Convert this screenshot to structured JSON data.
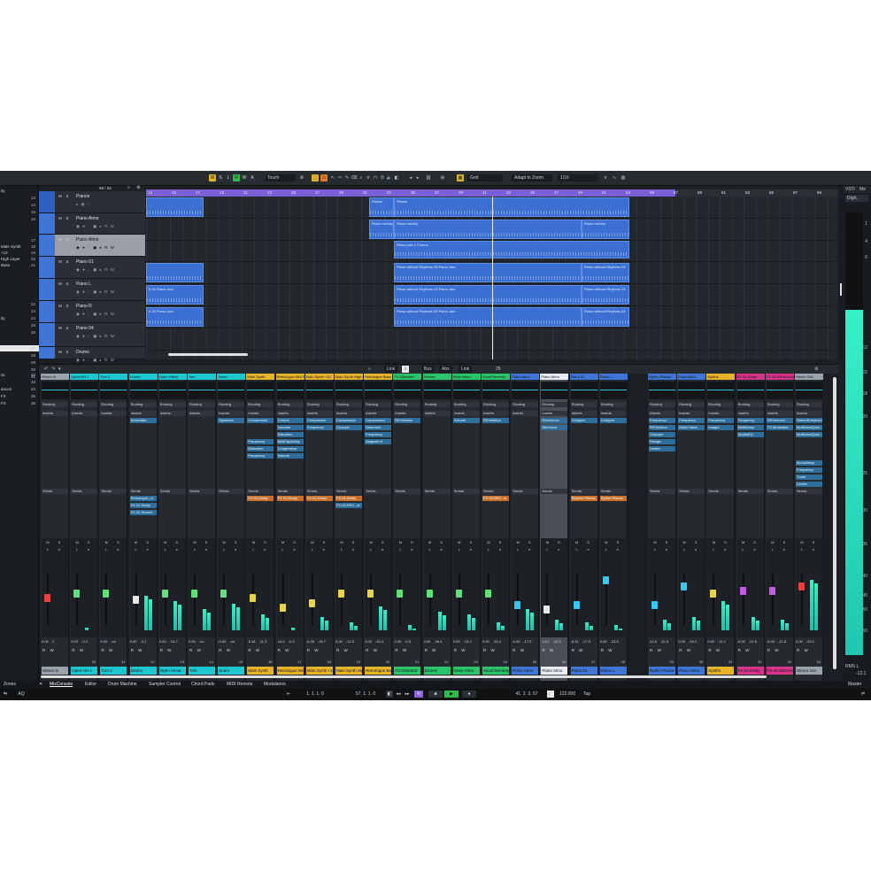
{
  "toolbar": {
    "buttons": [
      "M",
      "S",
      "L",
      "R",
      "W",
      "A"
    ],
    "automation_mode": "Touch",
    "snap_type": "Grid",
    "snap_mode": "Adapt to Zoom",
    "quantize": "1/16",
    "accent_color": "#e2b62b"
  },
  "left_zone": {
    "rows": [
      {
        "label": "ity",
        "num": ""
      },
      {
        "label": "",
        "num": "13"
      },
      {
        "label": "",
        "num": "14"
      },
      {
        "label": "",
        "num": "15"
      },
      {
        "label": "",
        "num": "16"
      },
      {
        "label": "",
        "num": "17"
      },
      {
        "label": "Male Synth",
        "num": "18"
      },
      {
        "label": "+12",
        "num": "19"
      },
      {
        "label": "High Layer",
        "num": "20"
      },
      {
        "label": "Bass",
        "num": "21"
      },
      {
        "label": "",
        "num": "22"
      },
      {
        "label": "",
        "num": "23"
      },
      {
        "label": "ity",
        "num": "24"
      },
      {
        "label": "",
        "num": "25"
      },
      {
        "label": "",
        "num": "26"
      },
      {
        "label": "",
        "num": "27"
      },
      {
        "label": "",
        "num": "28"
      },
      {
        "label": "",
        "num": "29"
      },
      {
        "label": "",
        "num": "30"
      },
      {
        "label": "",
        "num": "31"
      },
      {
        "label": "ss",
        "num": "32"
      },
      {
        "label": "",
        "num": "33"
      },
      {
        "label": "ances",
        "num": "34"
      },
      {
        "label": "FX",
        "num": "35"
      },
      {
        "label": "FX",
        "num": "36"
      }
    ],
    "zones_label": "Zones"
  },
  "tracks": {
    "header_value": "58 / 58",
    "list": [
      {
        "name": "Pianos",
        "folder": true
      },
      {
        "name": "Piano Atmo"
      },
      {
        "name": "Piano Atmo",
        "selected": true
      },
      {
        "name": "Piano 01"
      },
      {
        "name": "Piano L"
      },
      {
        "name": "Piano R"
      },
      {
        "name": "Piano 04"
      },
      {
        "name": "Drums"
      }
    ]
  },
  "ruler": {
    "bars": [
      "13",
      "15",
      "17",
      "19",
      "21",
      "23",
      "25",
      "27",
      "29",
      "31",
      "33",
      "35",
      "37",
      "39",
      "41",
      "43",
      "45",
      "47",
      "49",
      "51",
      "53",
      "55",
      "57",
      "59",
      "61",
      "63",
      "65",
      "67",
      "69"
    ]
  },
  "events": [
    {
      "lane": 0,
      "label": ""
    },
    {
      "lane": 0,
      "label": "Pianos"
    },
    {
      "lane": 0,
      "label": "Pianos"
    },
    {
      "lane": 1,
      "label": "Piano melody"
    },
    {
      "lane": 1,
      "label": "Piano melody"
    },
    {
      "lane": 1,
      "label": "Piano melody"
    },
    {
      "lane": 2,
      "label": "Piano part 4 Chorus"
    },
    {
      "lane": 3,
      "label": ""
    },
    {
      "lane": 3,
      "label": "Piano without Rhythms 25 Piano Jam"
    },
    {
      "lane": 3,
      "label": "Piano without Rhythms 25"
    },
    {
      "lane": 4,
      "label": "# 24 Piano Jam"
    },
    {
      "lane": 4,
      "label": "Piano without Rhythms 25 Piano Jam"
    },
    {
      "lane": 4,
      "label": "Piano without Rhythms 25"
    },
    {
      "lane": 5,
      "label": "# 25 Piano Jam"
    },
    {
      "lane": 5,
      "label": "Piano without Rhythms 25 Piano Jam"
    },
    {
      "lane": 5,
      "label": "Piano without Rhythms 25"
    }
  ],
  "mixer": {
    "toolbar": {
      "link1": "Link",
      "bus": "Bus",
      "abs": "Abs",
      "link2": "Link",
      "value": "26"
    },
    "section_labels": {
      "routing": "Routing",
      "inserts": "Inserts",
      "sends": "Sends"
    },
    "strips": [
      {
        "name": "Stereo In",
        "color": "#9aa3ad",
        "num": "",
        "inserts": [],
        "sends": [],
        "vol": "0.00",
        "pan": "C",
        "fader": 0.55,
        "meter": 0
      },
      {
        "name": "Open HH 1",
        "color": "#1ec7d0",
        "num": "10",
        "inserts": [],
        "sends": [],
        "vol": "0.00",
        "pan": "-0.3",
        "fader": 0.65,
        "meter": 0.05
      },
      {
        "name": "Tom 2",
        "color": "#1ec7d0",
        "num": "11",
        "inserts": [],
        "sends": [],
        "vol": "0.00",
        "pan": "-oo",
        "fader": 0.65,
        "meter": 0
      },
      {
        "name": "Drums",
        "color": "#1ec7d0",
        "num": "12",
        "inserts": [
          "Normalize"
        ],
        "sends": [
          "Retrologue_ut",
          "FX 01-Delay",
          "FX 02-Reverb"
        ],
        "vol": "0.00",
        "pan": "-3.1",
        "fader": 0.52,
        "meter": 0.65
      },
      {
        "name": "Open HiHat",
        "color": "#1ec7d0",
        "num": "13",
        "inserts": [],
        "sends": [],
        "vol": "0.00",
        "pan": "-14.7",
        "fader": 0.65,
        "meter": 0.55
      },
      {
        "name": "Tom",
        "color": "#1ec7d0",
        "num": "14",
        "inserts": [],
        "sends": [],
        "vol": "0.00",
        "pan": "-oo",
        "fader": 0.65,
        "meter": 0.4
      },
      {
        "name": "Snare",
        "color": "#1ec7d0",
        "num": "15",
        "inserts": [
          "Squasher"
        ],
        "sends": [],
        "vol": "-0.65",
        "pan": "-oo",
        "fader": 0.65,
        "meter": 0.5
      },
      {
        "name": "Main Synth",
        "color": "#e6b42a",
        "num": "16",
        "inserts": [
          "Compressor",
          "",
          "",
          "Frequency",
          "Distortion",
          "Frequency"
        ],
        "sends": [
          "FX 01-Delay"
        ],
        "vol": "-5.18",
        "pan": "-11.3",
        "fader": 0.55,
        "meter": 0.3
      },
      {
        "name": "Retrologue Mini Synth",
        "color": "#e6b42a",
        "num": "17",
        "inserts": [
          "Chorus",
          "Vocoder",
          "Distortion",
          "MultiTapDelay",
          "Compressor",
          "Volume"
        ],
        "sends": [
          "FX 01-Delay"
        ],
        "vol": "-14.0",
        "pan": "-0.3",
        "fader": 0.35,
        "meter": 0.05
      },
      {
        "name": "Main Synth +12",
        "color": "#e6b42a",
        "num": "18",
        "inserts": [
          "Compressor",
          "Frequency"
        ],
        "sends": [
          "FX 01-Delay"
        ],
        "vol": "-0.45",
        "pan": "-16.7",
        "fader": 0.45,
        "meter": 0.25
      },
      {
        "name": "Main Synth High Layer",
        "color": "#e6b42a",
        "num": "19",
        "inserts": [
          "Compressor",
          "Chopper"
        ],
        "sends": [
          "FX 01-Delay",
          "FX 02-REV...er"
        ],
        "vol": "0.00",
        "pan": "-12.3",
        "fader": 0.65,
        "meter": 0.15
      },
      {
        "name": "Retrologue Bass",
        "color": "#e6b42a",
        "num": "20",
        "inserts": [
          "Compressor",
          "Distortion",
          "Frequency",
          "Magneto II"
        ],
        "sends": [],
        "vol": "0.00",
        "pan": "-15.4",
        "fader": 0.65,
        "meter": 0.45
      },
      {
        "name": "FX Distorted",
        "color": "#2ac46a",
        "num": "21",
        "inserts": [
          "REVelation"
        ],
        "sends": [],
        "vol": "0.00",
        "pan": "-0.5",
        "fader": 0.65,
        "meter": 0.1
      },
      {
        "name": "Drones",
        "color": "#2ac46a",
        "num": "22",
        "inserts": [],
        "sends": [],
        "vol": "0.00",
        "pan": "-28.4",
        "fader": 0.65,
        "meter": 0.35
      },
      {
        "name": "Deep Atmo",
        "color": "#2ac46a",
        "num": "23",
        "inserts": [
          "Volume"
        ],
        "sends": [],
        "vol": "0.00",
        "pan": "-13.2",
        "fader": 0.65,
        "meter": 0.3
      },
      {
        "name": "Vocal Remedy",
        "color": "#2ac46a",
        "num": "24",
        "inserts": [
          "REVelation"
        ],
        "sends": [
          "FX 02-REV...er"
        ],
        "vol": "0.00",
        "pan": "-25.4",
        "fader": 0.65,
        "meter": 0.15
      },
      {
        "name": "Piano Atmo",
        "color": "#3f76d6",
        "num": "25",
        "inserts": [],
        "sends": [],
        "vol": "-4.00",
        "pan": "-17.5",
        "fader": 0.4,
        "meter": 0.4
      },
      {
        "name": "Piano Atmo",
        "color": "#e9edf2",
        "num": "26",
        "inserts": [
          "Reverence",
          "Stereoize"
        ],
        "sends": [],
        "vol": "-14.0",
        "pan": "-20.3",
        "fader": 0.3,
        "meter": 0.2,
        "selected": true
      },
      {
        "name": "Piano 01",
        "color": "#3f76d6",
        "num": "27",
        "inserts": [
          "Chopper"
        ],
        "sends": [
          "Rhythm Pianos"
        ],
        "vol": "-8.31",
        "pan": "-17.5",
        "fader": 0.4,
        "meter": 0.15
      },
      {
        "name": "Piano L",
        "color": "#3f76d6",
        "num": "28",
        "inserts": [
          "Chopper"
        ],
        "sends": [
          "Rythm Pianos"
        ],
        "vol": "0.00",
        "pan": "-23.5",
        "fader": 0.95,
        "meter": 0.1
      },
      {
        "name": "Rythm Pianos",
        "color": "#3f76d6",
        "num": "29",
        "inserts": [
          "Frequency",
          "REVelation",
          "Chopper",
          "Flanger",
          "Limiter"
        ],
        "sends": [],
        "vol": "-12.6",
        "pan": "-21.8",
        "fader": 0.4,
        "meter": 0.2
      },
      {
        "name": "Piano Atmo",
        "color": "#3f76d6",
        "num": "30",
        "inserts": [
          "Frequency",
          "Black Valve"
        ],
        "sends": [],
        "vol": "0.00",
        "pan": "-29.2",
        "fader": 0.8,
        "meter": 0.25
      },
      {
        "name": "Synths",
        "color": "#e6b42a",
        "num": "31",
        "inserts": [
          "Frequency",
          "Imager"
        ],
        "sends": [],
        "vol": "0.00",
        "pan": "-11.1",
        "fader": 0.65,
        "meter": 0.55
      },
      {
        "name": "FX 01-Delay",
        "color": "#d6348d",
        "num": "32",
        "inserts": [
          "Frequency",
          "MultiDelay",
          "StudioEQ"
        ],
        "sends": [],
        "vol": "-0.00",
        "pan": "-21.8",
        "fader": 0.72,
        "meter": 0.25
      },
      {
        "name": "FX 02-REVerence",
        "color": "#d6348d",
        "num": "33",
        "inserts": [
          "REVerence",
          "FX Modulator"
        ],
        "sends": [],
        "vol": "-0.00",
        "pan": "-21.8",
        "fader": 0.72,
        "meter": 0.2
      },
      {
        "name": "Stereo Out",
        "color": "#9aa3ad",
        "num": "34",
        "inserts": [
          "StereoEnhancer",
          "MultibandQuin...er",
          "MultibandQuin...er",
          "",
          "",
          "",
          "MonoDelay",
          "Frequency",
          "Tuner",
          "Limiter"
        ],
        "sends": [],
        "vol": "0.00",
        "pan": "-20.1",
        "fader": 0.8,
        "meter": 0.95
      }
    ]
  },
  "right_panel": {
    "tabs": [
      "VSTi",
      "Me"
    ],
    "dropdown": "Digit..",
    "scale": [
      "1",
      "4",
      "6",
      "12",
      "15",
      "18",
      "20",
      "25",
      "30",
      "35",
      "40",
      "45",
      "50",
      "60"
    ],
    "rms_label": "RMS L",
    "rms_value": "-12.1",
    "footer": "Master"
  },
  "bottom_tabs": [
    "MixConsole",
    "Editor",
    "Drum Machine",
    "Sampler Control",
    "Chord Pads",
    "MIDI Remote",
    "Modulators"
  ],
  "transport": {
    "left_locator": "1. 1. 1.   0",
    "right_locator": "57. 1. 1.   0",
    "position": "41. 2. 3.  57",
    "tempo": "122.000",
    "tap": "Tap",
    "aq": "AQ"
  }
}
